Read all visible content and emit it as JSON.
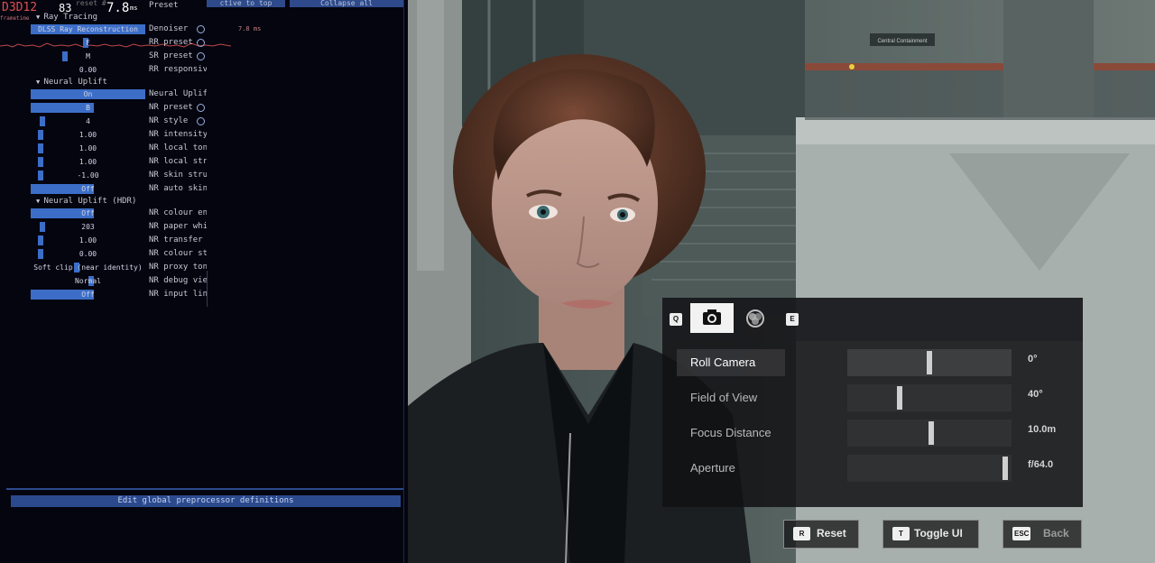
{
  "debug_panel": {
    "counter": "D3D12",
    "fps": "83",
    "frame_ms": "7.8",
    "frame_ms_unit": "ms",
    "frame_ms_small": "7.8 ms",
    "frametime_label": "frametime",
    "preset_header": "Preset",
    "preset_ghost": "reset #",
    "top_buttons": [
      "ctive to top",
      "Collapse all"
    ],
    "sections": [
      {
        "title": "Ray Tracing"
      },
      {
        "title": "Neural Uplift"
      },
      {
        "title": "Neural Uplift (HDR)"
      }
    ],
    "rows": [
      {
        "value": "DLSS Ray Reconstruction",
        "label": "Denoiser",
        "fill": 1.0
      },
      {
        "value": "F",
        "label": "RR preset",
        "fill": 0.3
      },
      {
        "value": "M",
        "label": "SR preset",
        "fill": 0.18
      },
      {
        "value": "0.00",
        "label": "RR responsiv",
        "fill": 0.0
      },
      {
        "value": "On",
        "label": "Neural Uplif",
        "fill": 1.0
      },
      {
        "value": "B",
        "label": "NR preset",
        "fill": 0.55
      },
      {
        "value": "4",
        "label": "NR style",
        "fill": 0.05
      },
      {
        "value": "1.00",
        "label": "NR intensity",
        "fill": 0.04
      },
      {
        "value": "1.00",
        "label": "NR local ton",
        "fill": 0.04
      },
      {
        "value": "1.00",
        "label": "NR local str",
        "fill": 0.04
      },
      {
        "value": "-1.00",
        "label": "NR skin stru",
        "fill": 0.04
      },
      {
        "value": "Off",
        "label": "NR auto skin",
        "fill": 0.55
      },
      {
        "value": "Off",
        "label": "NR colour en",
        "fill": 0.55
      },
      {
        "value": "203",
        "label": "NR paper whi",
        "fill": 0.05
      },
      {
        "value": "1.00",
        "label": "NR transfer",
        "fill": 0.04
      },
      {
        "value": "0.00",
        "label": "NR colour st",
        "fill": 0.04
      },
      {
        "value": "Soft clip (near identity)",
        "label": "NR proxy ton",
        "fill": 0.25
      },
      {
        "value": "Normal",
        "label": "NR debug vie",
        "fill": 0.33
      },
      {
        "value": "Off",
        "label": "NR input lin",
        "fill": 0.55
      }
    ],
    "footer_button": "Edit global preprocessor definitions"
  },
  "scene": {
    "wall_sign": "Central Containment"
  },
  "photo_mode": {
    "tab_keys": {
      "prev": "Q",
      "next": "E"
    },
    "tabs": [
      {
        "icon": "camera-icon",
        "active": true
      },
      {
        "icon": "filter-icon",
        "active": false
      }
    ],
    "sliders": [
      {
        "label": "Roll Camera",
        "value": "0°",
        "position": 0.5,
        "active": true
      },
      {
        "label": "Field of View",
        "value": "40°",
        "position": 0.31,
        "active": false
      },
      {
        "label": "Focus Distance",
        "value": "10.0m",
        "position": 0.51,
        "active": false
      },
      {
        "label": "Aperture",
        "value": "f/64.0",
        "position": 0.98,
        "active": false
      }
    ],
    "buttons": [
      {
        "key": "R",
        "label": "Reset"
      },
      {
        "key": "T",
        "label": "Toggle UI"
      },
      {
        "key": "ESC",
        "label": "Back"
      }
    ],
    "accent": "#f2f2f2"
  }
}
